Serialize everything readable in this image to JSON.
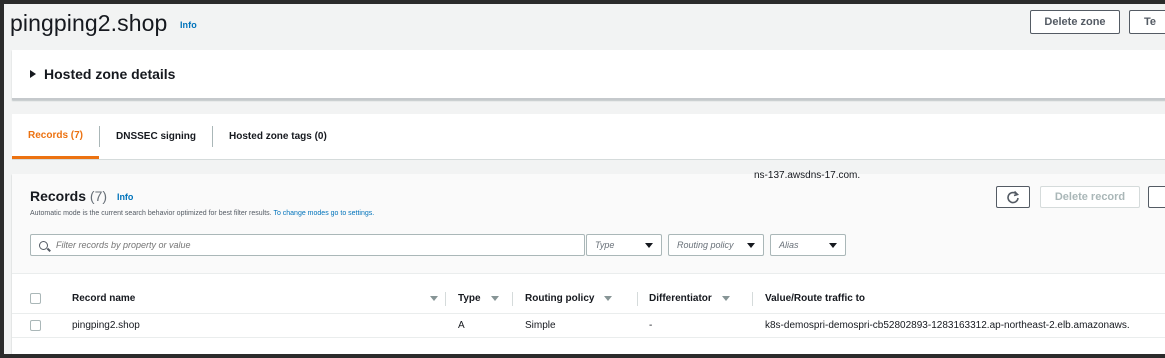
{
  "header": {
    "zone_name": "pingping2.shop",
    "info_label": "Info",
    "delete_zone_label": "Delete zone",
    "test_label": "Te"
  },
  "details": {
    "title": "Hosted zone details"
  },
  "tabs": [
    {
      "label": "Records (7)",
      "active": true
    },
    {
      "label": "DNSSEC signing",
      "active": false
    },
    {
      "label": "Hosted zone tags (0)",
      "active": false
    }
  ],
  "records": {
    "title": "Records",
    "count": "(7)",
    "info_label": "Info",
    "description": "Automatic mode is the current search behavior optimized for best filter results.",
    "description_link": "To change modes go to settings.",
    "search_placeholder": "Filter records by property or value",
    "filter_type": "Type",
    "filter_routing": "Routing policy",
    "filter_alias": "Alias",
    "delete_record_label": "Delete record"
  },
  "table": {
    "columns": [
      "Record name",
      "Type",
      "Routing policy",
      "Differentiator",
      "Value/Route traffic to"
    ],
    "rows": [
      {
        "record_name": "pingping2.shop",
        "type": "A",
        "routing_policy": "Simple",
        "differentiator": "-",
        "value": "k8s-demospri-demospri-cb52802893-1283163312.ap-northeast-2.elb.amazonaws.",
        "value_next": "ns-137.awsdns-17.com."
      }
    ]
  },
  "colors": {
    "accent": "#ec7211",
    "link": "#0073bb",
    "text": "#16191f"
  }
}
